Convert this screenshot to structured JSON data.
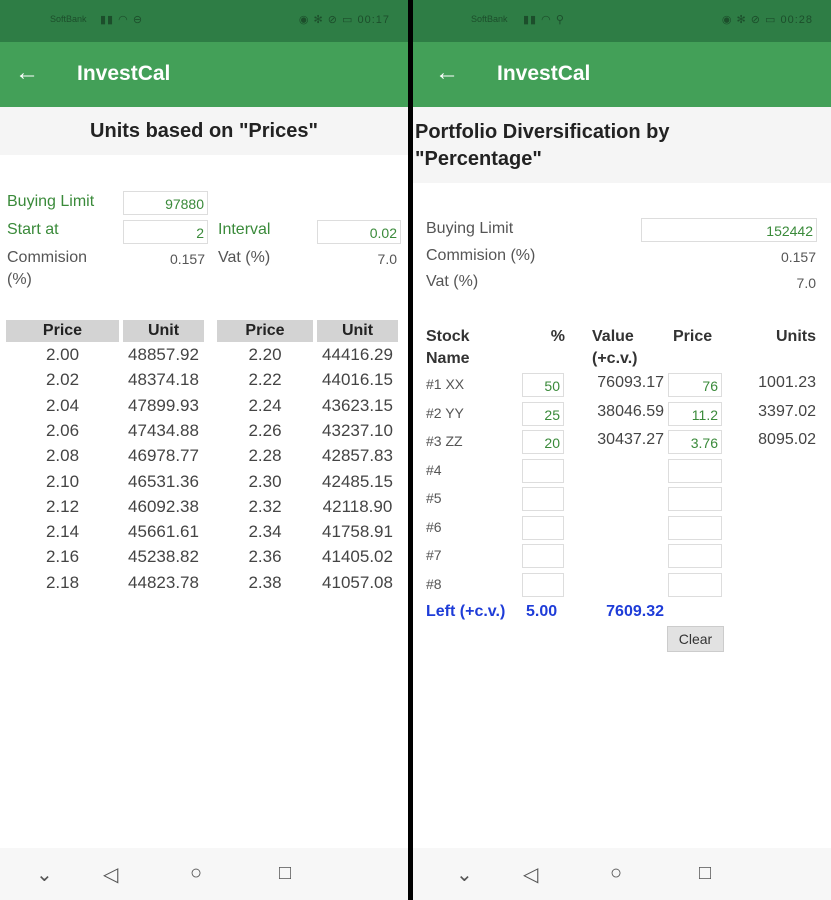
{
  "left": {
    "status": {
      "carrier": "SoftBank",
      "signal": "▮▮ ◠ ⊖",
      "right": "◉ ✻ ⊘ ▭ 00:17"
    },
    "app": {
      "back": "←",
      "title": "InvestCal"
    },
    "heading": "Units based on \"Prices\"",
    "form": {
      "buying_limit_label": "Buying Limit",
      "buying_limit_value": "97880",
      "start_label": "Start at",
      "start_value": "2",
      "interval_label": "Interval",
      "interval_value": "0.02",
      "commission_label": "Commision",
      "commission_unit": "(%)",
      "commission_value": "0.157",
      "vat_label": "Vat (%)",
      "vat_value": "7.0"
    },
    "table": {
      "headers": [
        "Price",
        "Unit",
        "Price",
        "Unit"
      ],
      "col1": [
        [
          "2.00",
          "48857.92"
        ],
        [
          "2.02",
          "48374.18"
        ],
        [
          "2.04",
          "47899.93"
        ],
        [
          "2.06",
          "47434.88"
        ],
        [
          "2.08",
          "46978.77"
        ],
        [
          "2.10",
          "46531.36"
        ],
        [
          "2.12",
          "46092.38"
        ],
        [
          "2.14",
          "45661.61"
        ],
        [
          "2.16",
          "45238.82"
        ],
        [
          "2.18",
          "44823.78"
        ]
      ],
      "col2": [
        [
          "2.20",
          "44416.29"
        ],
        [
          "2.22",
          "44016.15"
        ],
        [
          "2.24",
          "43623.15"
        ],
        [
          "2.26",
          "43237.10"
        ],
        [
          "2.28",
          "42857.83"
        ],
        [
          "2.30",
          "42485.15"
        ],
        [
          "2.32",
          "42118.90"
        ],
        [
          "2.34",
          "41758.91"
        ],
        [
          "2.36",
          "41405.02"
        ],
        [
          "2.38",
          "41057.08"
        ]
      ]
    },
    "nav": {
      "down": "⌄",
      "back": "◁",
      "home": "○",
      "recent": "□"
    }
  },
  "right": {
    "status": {
      "carrier": "SoftBank",
      "signal": "▮▮ ◠ ⚲",
      "right": "◉ ✻ ⊘ ▭ 00:28"
    },
    "app": {
      "back": "←",
      "title": "InvestCal"
    },
    "heading_line1": "Portfolio Diversification by",
    "heading_line2": "\"Percentage\"",
    "form": {
      "buying_limit_label": "Buying Limit",
      "buying_limit_value": "152442",
      "commission_label": "Commision (%)",
      "commission_value": "0.157",
      "vat_label": "Vat (%)",
      "vat_value": "7.0"
    },
    "table": {
      "h_stock1": "Stock",
      "h_stock2": "Name",
      "h_pct": "%",
      "h_value1": "Value",
      "h_value2": "(+c.v.)",
      "h_price": "Price",
      "h_units": "Units",
      "rows": [
        {
          "name": "#1 XX",
          "pct": "50",
          "value": "76093.17",
          "price": "76",
          "units": "1001.23"
        },
        {
          "name": "#2 YY",
          "pct": "25",
          "value": "38046.59",
          "price": "11.2",
          "units": "3397.02"
        },
        {
          "name": "#3 ZZ",
          "pct": "20",
          "value": "30437.27",
          "price": "3.76",
          "units": "8095.02"
        },
        {
          "name": "#4",
          "pct": "",
          "value": "",
          "price": "",
          "units": ""
        },
        {
          "name": "#5",
          "pct": "",
          "value": "",
          "price": "",
          "units": ""
        },
        {
          "name": "#6",
          "pct": "",
          "value": "",
          "price": "",
          "units": ""
        },
        {
          "name": "#7",
          "pct": "",
          "value": "",
          "price": "",
          "units": ""
        },
        {
          "name": "#8",
          "pct": "",
          "value": "",
          "price": "",
          "units": ""
        }
      ],
      "left_label": "Left (+c.v.)",
      "left_pct": "5.00",
      "left_value": "7609.32",
      "clear": "Clear"
    },
    "nav": {
      "down": "⌄",
      "back": "◁",
      "home": "○",
      "recent": "□"
    }
  }
}
